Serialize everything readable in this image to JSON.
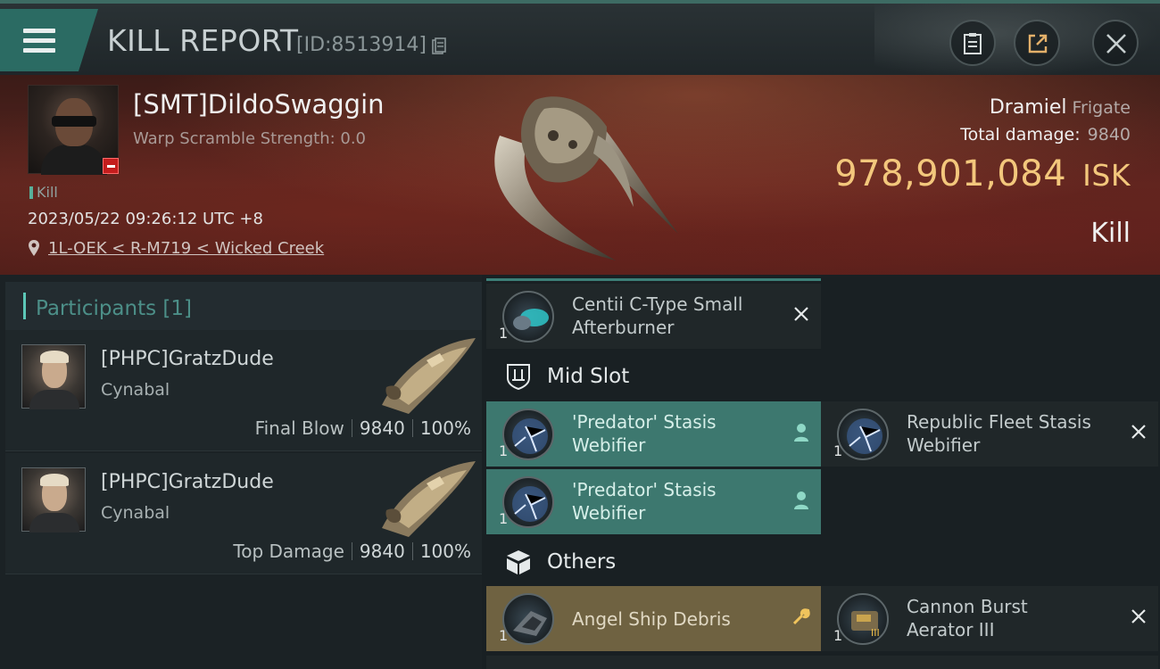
{
  "header": {
    "title": "KILL REPORT",
    "id_label": "[ID:8513914]"
  },
  "victim": {
    "name": "[SMT]DildoSwaggin",
    "scramble": "Warp Scramble Strength: 0.0",
    "kill_tag": "Kill",
    "time": "2023/05/22 09:26:12 UTC +8",
    "location": "1L-OEK < R-M719 < Wicked Creek"
  },
  "summary": {
    "ship_name": "Dramiel",
    "ship_class": "Frigate",
    "total_damage_label": "Total damage:",
    "total_damage": "9840",
    "isk_value": "978,901,084",
    "isk_unit": "ISK",
    "result": "Kill"
  },
  "participants": {
    "title": "Participants [1]",
    "items": [
      {
        "name": "[PHPC]GratzDude",
        "ship": "Cynabal",
        "label": "Final Blow",
        "damage": "9840",
        "percent": "100%"
      },
      {
        "name": "[PHPC]GratzDude",
        "ship": "Cynabal",
        "label": "Top Damage",
        "damage": "9840",
        "percent": "100%"
      }
    ]
  },
  "fittings": {
    "low_item": {
      "qty": "1",
      "name": "Centii C-Type Small\nAfterburner",
      "status": "destroyed"
    },
    "mid_label": "Mid Slot",
    "mid_items": [
      {
        "qty": "1",
        "name": "'Predator' Stasis\nWebifier",
        "status": "dropped"
      },
      {
        "qty": "1",
        "name": "Republic Fleet Stasis\nWebifier",
        "status": "destroyed"
      },
      {
        "qty": "1",
        "name": "'Predator' Stasis\nWebifier",
        "status": "dropped"
      }
    ],
    "others_label": "Others",
    "other_items": [
      {
        "qty": "1",
        "name": "Angel Ship Debris",
        "status": "salvage"
      },
      {
        "qty": "1",
        "name": "Cannon Burst\nAerator III",
        "status": "destroyed"
      }
    ]
  },
  "colors": {
    "accent": "#3d786f",
    "isk": "#f3c77c",
    "salvage": "#6f6241",
    "badge": "#c41d1d"
  },
  "icons": [
    "menu-icon",
    "copy-icon",
    "clipboard-icon",
    "share-icon",
    "close-icon",
    "location-pin-icon",
    "person-icon",
    "x-icon",
    "wrench-icon",
    "shield-icon",
    "box-icon"
  ]
}
